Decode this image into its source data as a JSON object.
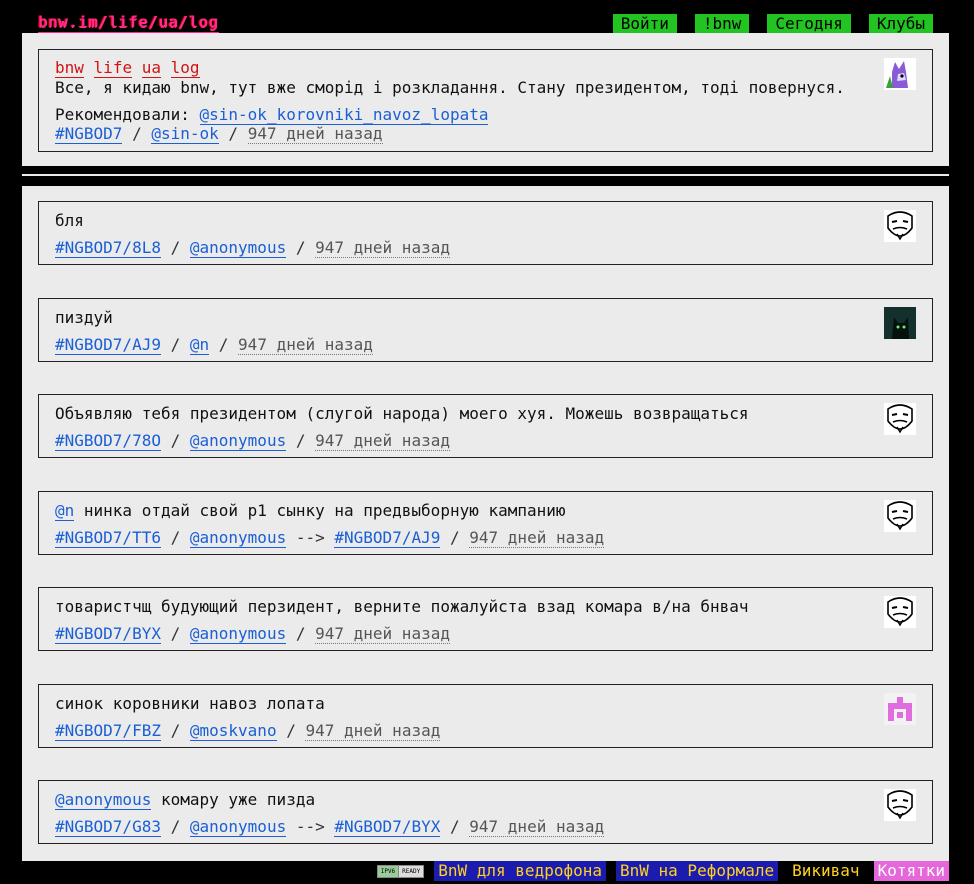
{
  "header": {
    "logo_text": "bnw.im/life/ua/log",
    "nav": [
      "Войти",
      "!bnw",
      "Сегодня",
      "Клубы"
    ]
  },
  "post": {
    "tags": [
      "bnw",
      "life",
      "ua",
      "log"
    ],
    "text": "Все, я кидаю bnw, тут вже сморід і розкладання. Стану президентом, тоді повернуся.",
    "recommended_label": "Рекомендовали: ",
    "recommended_user": "@sin-ok_korovniki_navoz_lopata",
    "id": "#NGBOD7",
    "author": "@sin-ok",
    "date": "947 дней назад"
  },
  "comments": [
    {
      "text": "бля",
      "id": "#NGBOD7/8L8",
      "author": "@anonymous",
      "date": "947 дней назад",
      "avatar": "anonymous-mask"
    },
    {
      "text": "пиздуй",
      "id": "#NGBOD7/AJ9",
      "author": "@n",
      "date": "947 дней назад",
      "avatar": "dark-cat"
    },
    {
      "text": "Объявляю тебя президентом (слугой народа) моего хуя. Можешь возвращаться",
      "id": "#NGBOD7/78O",
      "author": "@anonymous",
      "date": "947 дней назад",
      "avatar": "anonymous-mask"
    },
    {
      "mention": "@n",
      "text": " нинка отдай свой р1 сынку на предвыборную кампанию",
      "id": "#NGBOD7/TT6",
      "author": "@anonymous",
      "arrow": "-->",
      "reply_to": "#NGBOD7/AJ9",
      "date": "947 дней назад",
      "avatar": "anonymous-mask"
    },
    {
      "text": "товаристчщ будующий перзидент, верните пожалуйста взад комара в/на бнвач",
      "id": "#NGBOD7/BYX",
      "author": "@anonymous",
      "date": "947 дней назад",
      "avatar": "anonymous-mask"
    },
    {
      "text": "синок коровники навоз лопата",
      "id": "#NGBOD7/FBZ",
      "author": "@moskvano",
      "date": "947 дней назад",
      "avatar": "pixel-identicon"
    },
    {
      "mention": "@anonymous",
      "text": " комару уже пизда",
      "id": "#NGBOD7/G83",
      "author": "@anonymous",
      "arrow": "-->",
      "reply_to": "#NGBOD7/BYX",
      "date": "947 дней назад",
      "avatar": "anonymous-mask"
    }
  ],
  "footer": {
    "badge_left": "IPV6",
    "badge_right": "READY",
    "links": [
      "BnW для ведрофона",
      "BnW на Реформале",
      "Викивач",
      "Котятки"
    ]
  },
  "colors": {
    "accent_link": "#1a5fd6",
    "tag_red": "#d01414",
    "nav_green": "#21c421",
    "footer_blue": "#1b1bb0",
    "footer_pink": "#e667d9"
  }
}
